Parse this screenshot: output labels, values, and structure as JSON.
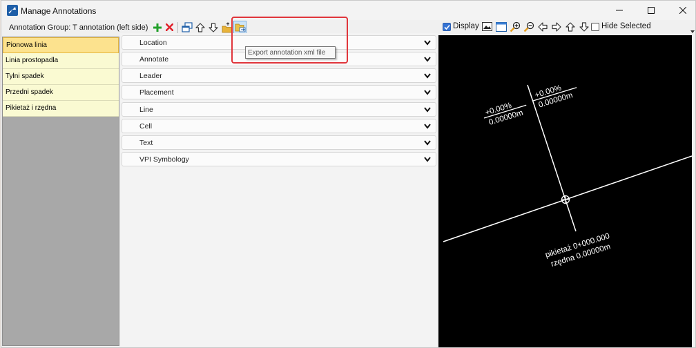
{
  "window": {
    "title": "Manage Annotations",
    "controls": [
      "minimize",
      "maximize",
      "close"
    ]
  },
  "toolbar": {
    "group_label": "Annotation Group: T annotation (left side)",
    "buttons": [
      "add-icon",
      "delete-icon",
      "copy-icon",
      "move-up-icon",
      "move-down-icon",
      "import-icon",
      "export-icon"
    ]
  },
  "tooltip": {
    "text": "Export annotation xml file"
  },
  "annotations": {
    "items": [
      {
        "label": "Pionowa linia",
        "active": true
      },
      {
        "label": "Linia prostopadla",
        "active": false
      },
      {
        "label": "Tylni spadek",
        "active": false
      },
      {
        "label": "Przedni spadek",
        "active": false
      },
      {
        "label": "Pikietaż i rzędna",
        "active": false
      }
    ]
  },
  "sections": [
    {
      "label": "Location"
    },
    {
      "label": "Annotate"
    },
    {
      "label": "Leader"
    },
    {
      "label": "Placement"
    },
    {
      "label": "Line"
    },
    {
      "label": "Cell"
    },
    {
      "label": "Text"
    },
    {
      "label": "VPI Symbology"
    }
  ],
  "preview_toolbar": {
    "display_label": "Display",
    "display_checked": true,
    "hide_selected_label": "Hide Selected",
    "hide_selected_checked": false,
    "buttons": [
      "image-icon",
      "window-icon",
      "zoom-in-icon",
      "zoom-out-icon",
      "pan-left-icon",
      "pan-right-icon",
      "pan-up-icon",
      "pan-down-icon"
    ]
  },
  "preview": {
    "left_label": {
      "line1": "+0.00%",
      "line2": "0.00000m"
    },
    "right_label": {
      "line1": "+0.00%",
      "line2": "0.00000m"
    },
    "station_label": {
      "line1": "pikietaż 0+000.000",
      "line2": "rzędna 0.00000m"
    }
  },
  "colors": {
    "highlight": "#e0353b",
    "active_item": "#fce28e",
    "item_bg": "#fafad2",
    "list_bg": "#a8a8a8",
    "preview_bg": "#000000",
    "checkbox": "#3574d4"
  }
}
